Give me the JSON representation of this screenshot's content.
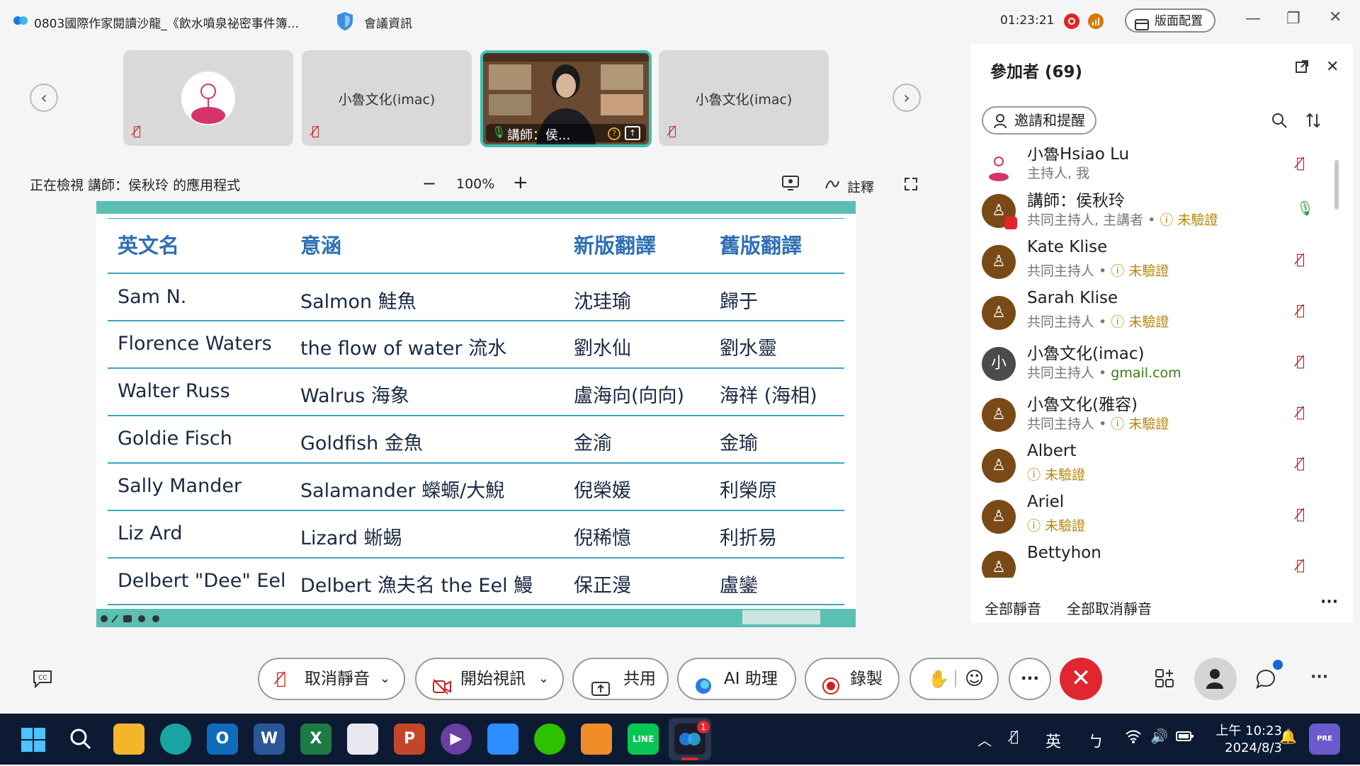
{
  "titlebar": {
    "meeting_title": "0803國際作家閱讀沙龍_《飲水噴泉祕密事件簿...",
    "meeting_info": "會議資訊",
    "timer": "01:23:21",
    "layout_button": "版面配置"
  },
  "video_strip": {
    "tiles": [
      {
        "name": ""
      },
      {
        "name": "小魯文化(imac)"
      },
      {
        "name": "講師：侯..."
      },
      {
        "name": "小魯文化(imac)"
      }
    ]
  },
  "viewing": {
    "label": "正在檢視 講師：侯秋玲 的應用程式",
    "zoom_minus": "−",
    "zoom_value": "100%",
    "zoom_plus": "+",
    "annotate": "註釋"
  },
  "slide_table": {
    "headers": [
      "英文名",
      "意涵",
      "新版翻譯",
      "舊版翻譯"
    ],
    "rows": [
      [
        "Sam N.",
        "Salmon 鮭魚",
        "沈珪瑜",
        "歸于"
      ],
      [
        "Florence Waters",
        "the flow of water 流水",
        "劉水仙",
        "劉水靈"
      ],
      [
        "Walter Russ",
        "Walrus 海象",
        "盧海向(向向)",
        "海祥 (海相)"
      ],
      [
        "Goldie Fisch",
        "Goldfish 金魚",
        "金渝",
        "金瑜"
      ],
      [
        "Sally Mander",
        "Salamander 蠑螈/大鯢",
        "倪榮媛",
        "利榮原"
      ],
      [
        "Liz Ard",
        "Lizard 蜥蜴",
        "倪稀憶",
        "利折易"
      ],
      [
        "Delbert \"Dee\" Eel",
        "Delbert 漁夫名  the Eel 鰻",
        "保正漫",
        "盧鑾"
      ]
    ]
  },
  "participants": {
    "title": "參加者 (69)",
    "invite": "邀請和提醒",
    "list": [
      {
        "name": "小魯Hsiao Lu",
        "role": "主持人, 我",
        "extra": "",
        "mic": "off",
        "avatar": ""
      },
      {
        "name": "講師：侯秋玲",
        "role": "共同主持人, 主講者 • ",
        "extra": "未驗證",
        "mic": "on",
        "avatar": "♙"
      },
      {
        "name": "Kate Klise",
        "role": "共同主持人 • ",
        "extra": "未驗證",
        "mic": "off",
        "avatar": "♙"
      },
      {
        "name": "Sarah Klise",
        "role": "共同主持人 • ",
        "extra": "未驗證",
        "mic": "off",
        "avatar": "♙"
      },
      {
        "name": "小魯文化(imac)",
        "role": "共同主持人 • ",
        "extra": "gmail.com",
        "mic": "off",
        "avatar": "小"
      },
      {
        "name": "小魯文化(雅容)",
        "role": "共同主持人 • ",
        "extra": "未驗證",
        "mic": "off",
        "avatar": "♙"
      },
      {
        "name": "Albert",
        "role": "",
        "extra": "未驗證",
        "mic": "off",
        "avatar": "♙"
      },
      {
        "name": "Ariel",
        "role": "",
        "extra": "未驗證",
        "mic": "off",
        "avatar": "♙"
      },
      {
        "name": "Bettyhon",
        "role": "",
        "extra": "",
        "mic": "off",
        "avatar": "♙"
      }
    ],
    "mute_all": "全部靜音",
    "unmute_all": "全部取消靜音"
  },
  "toolbar": {
    "unmute": "取消靜音",
    "start_video": "開始視訊",
    "share": "共用",
    "ai": "AI 助理",
    "record": "錄製",
    "more": "···"
  },
  "taskbar": {
    "ime_lang": "英",
    "ime_mode": "ㄅ",
    "time": "上午 10:23",
    "date": "2024/8/3",
    "webex_badge": "1"
  },
  "colors": {
    "accent_blue": "#2f6fb4",
    "slide_teal": "#5bbfb3",
    "end_red": "#e0262f",
    "unverified": "#b8860b"
  }
}
